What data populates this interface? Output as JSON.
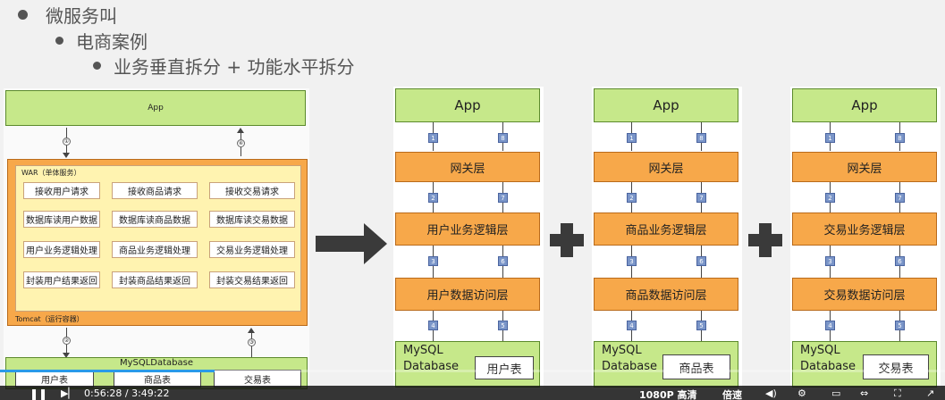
{
  "bullets": {
    "l1": "微服务叫",
    "l2": "电商案例",
    "l3": "业务垂直拆分 + 功能水平拆分"
  },
  "left": {
    "app": "App",
    "war": "WAR（单体服务）",
    "grid": [
      [
        "接收用户请求",
        "接收商品请求",
        "接收交易请求"
      ],
      [
        "数据库读用户数据",
        "数据库读商品数据",
        "数据库读交易数据"
      ],
      [
        "用户业务逻辑处理",
        "商品业务逻辑处理",
        "交易业务逻辑处理"
      ],
      [
        "封装用户结果返回",
        "封装商品结果返回",
        "封装交易结果返回"
      ]
    ],
    "tomcat": "Tomcat（运行容器）",
    "db": "MySQLDatabase",
    "tables": [
      "用户表",
      "商品表",
      "交易表"
    ],
    "n1": "①",
    "n2": "②",
    "n3": "③",
    "n4": "④"
  },
  "stacks": [
    {
      "app": "App",
      "gateway": "网关层",
      "logic": "用户业务逻辑层",
      "dao": "用户数据访问层",
      "db1": "MySQL",
      "db2": "Database",
      "table": "用户表"
    },
    {
      "app": "App",
      "gateway": "网关层",
      "logic": "商品业务逻辑层",
      "dao": "商品数据访问层",
      "db1": "MySQL",
      "db2": "Database",
      "table": "商品表"
    },
    {
      "app": "App",
      "gateway": "网关层",
      "logic": "交易业务逻辑层",
      "dao": "交易数据访问层",
      "db1": "MySQL",
      "db2": "Database",
      "table": "交易表"
    }
  ],
  "nums": {
    "a": "1",
    "b": "2",
    "c": "3",
    "d": "4",
    "e": "5",
    "f": "6",
    "g": "7",
    "h": "8"
  },
  "player": {
    "time": "0:56:28 / 3:49:22",
    "quality": "1080P 高清",
    "speed": "倍速"
  },
  "colors": {
    "green": "#c6e88a",
    "orange": "#f7a84a",
    "blue": "#7a95c8"
  }
}
